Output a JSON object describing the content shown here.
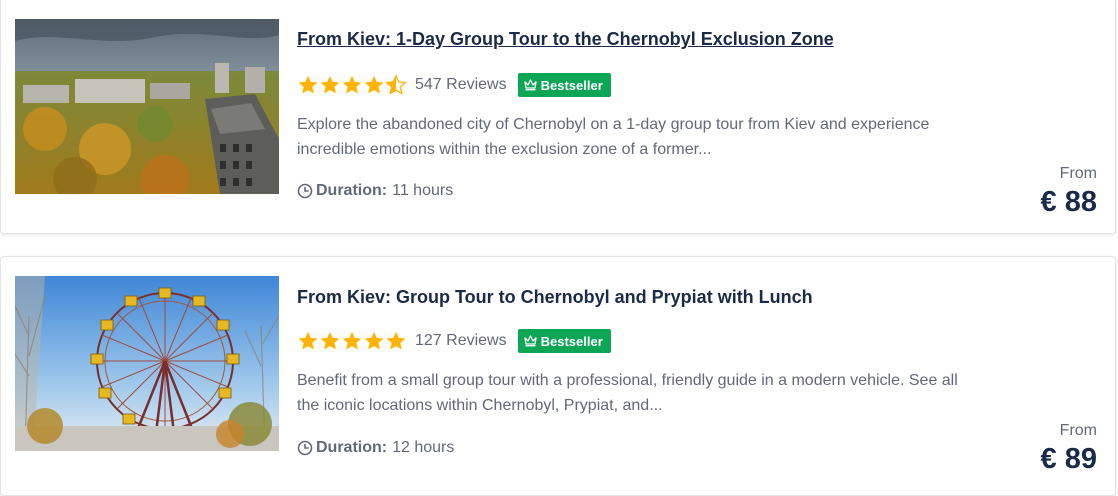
{
  "tours": [
    {
      "title": "From Kiev: 1-Day Group Tour to the Chernobyl Exclusion Zone",
      "rating": 4.5,
      "reviews": "547 Reviews",
      "badge": "Bestseller",
      "description_line1": "Explore the abandoned city of Chernobyl on a 1-day group tour from Kiev and experience",
      "description_line2": "incredible emotions within the exclusion zone of a former...",
      "duration_label": "Duration:",
      "duration_value": "11 hours",
      "from_label": "From",
      "price": "€ 88",
      "image_icon": "abandoned-city-photo"
    },
    {
      "title": "From Kiev: Group Tour to Chernobyl and Prypiat with Lunch",
      "rating": 5,
      "reviews": "127 Reviews",
      "badge": "Bestseller",
      "description_line1": "Benefit from a small group tour with a professional, friendly guide in a modern vehicle. See all",
      "description_line2": "the iconic locations within Chernobyl, Prypiat, and...",
      "duration_label": "Duration:",
      "duration_value": "12 hours",
      "from_label": "From",
      "price": "€ 89",
      "image_icon": "ferris-wheel-photo"
    }
  ],
  "colors": {
    "title": "#1a2b49",
    "text": "#63687a",
    "star": "#ffb400",
    "badge": "#0da556"
  }
}
